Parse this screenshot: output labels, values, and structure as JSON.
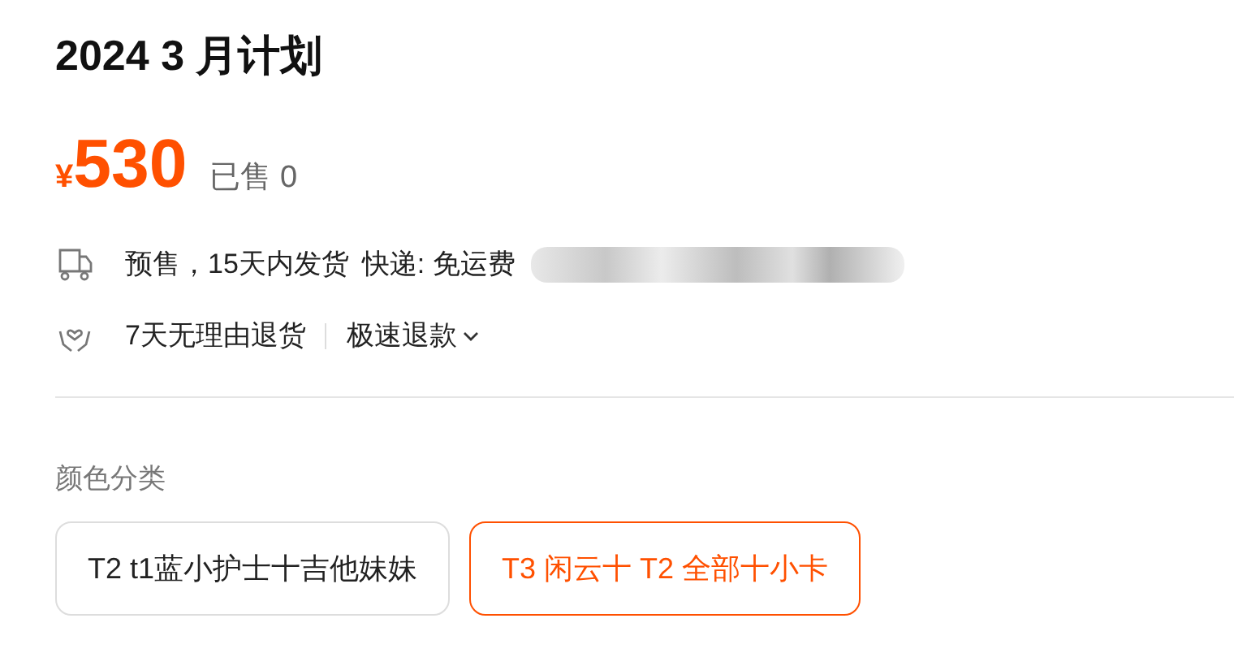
{
  "title": "2024 3 月计划",
  "price": {
    "currency": "¥",
    "amount": "530",
    "sold": "已售 0"
  },
  "shipping": {
    "text": "预售，15天内发货",
    "express": "快递: 免运费"
  },
  "service": {
    "text": "7天无理由退货",
    "refund": "极速退款"
  },
  "options": {
    "label": "颜色分类",
    "items": [
      {
        "label": "T2 t1蓝小护士十吉他妹妹",
        "selected": false
      },
      {
        "label": "T3 闲云十 T2 全部十小卡",
        "selected": true
      }
    ]
  }
}
